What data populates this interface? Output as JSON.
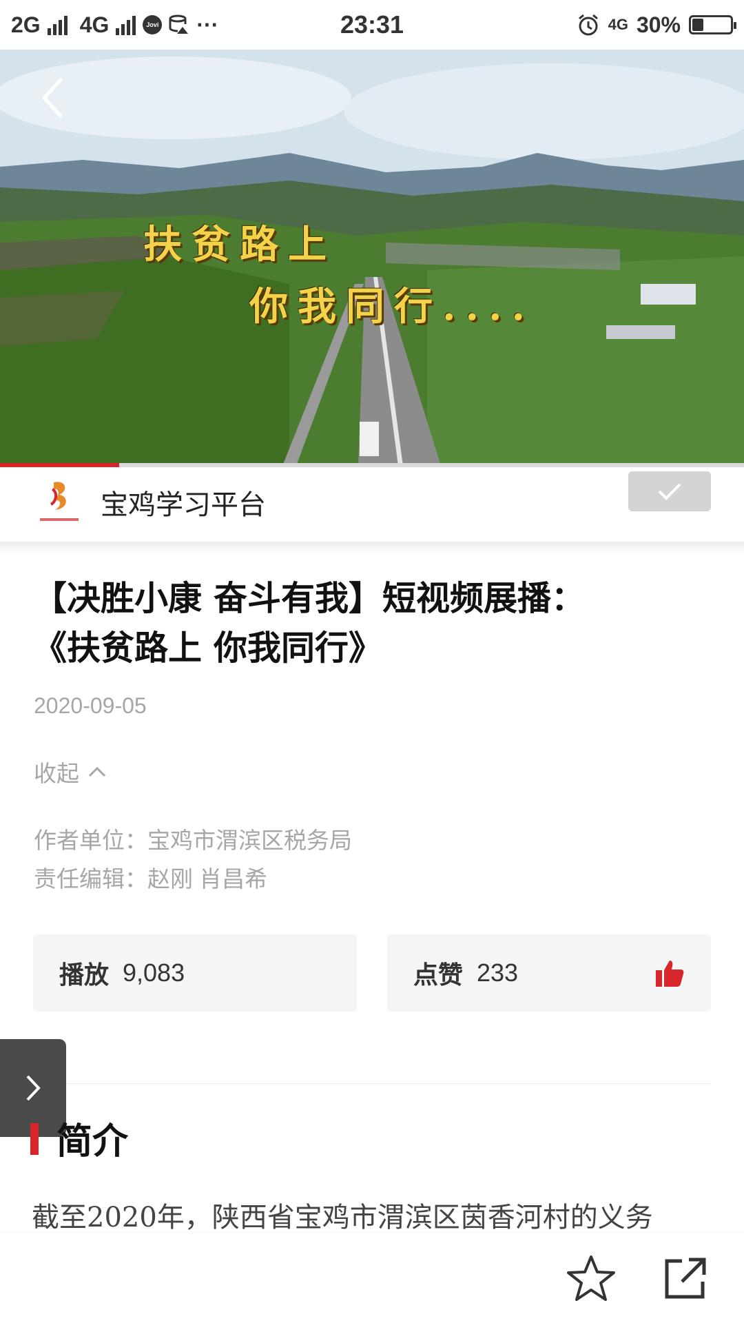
{
  "status_bar": {
    "network1": "2G",
    "network2": "4G",
    "jovi": "Jovi",
    "more": "···",
    "time": "23:31",
    "lte": "4G",
    "battery": "30%",
    "battery_level": 0.3
  },
  "video": {
    "caption_line1": "扶贫路上",
    "caption_line2": "你我同行....",
    "progress": 0.16
  },
  "channel": {
    "name": "宝鸡学习平台"
  },
  "article": {
    "title_line1": "【决胜小康 奋斗有我】短视频展播：",
    "title_line2": "《扶贫路上 你我同行》",
    "date": "2020-09-05",
    "collapse_label": "收起",
    "author_unit": "作者单位：宝鸡市渭滨区税务局",
    "editor": "责任编辑：赵刚 肖昌希"
  },
  "stats": {
    "play_label": "播放",
    "play_value": "9,083",
    "like_label": "点赞",
    "like_value": "233"
  },
  "intro": {
    "heading": "简介",
    "text": "截至2020年，陕西省宝鸡市渭滨区茵香河村的义务"
  },
  "colors": {
    "accent": "#d6262b",
    "muted_text": "#a6a6a6",
    "stat_bg": "#f4f5f7"
  },
  "icons": {
    "back": "chevron-left-icon",
    "follow": "check-icon",
    "collapse": "chevron-up-icon",
    "like": "thumbs-up-icon",
    "side_tab": "chevron-right-icon",
    "favorite": "star-icon",
    "share": "share-icon"
  }
}
